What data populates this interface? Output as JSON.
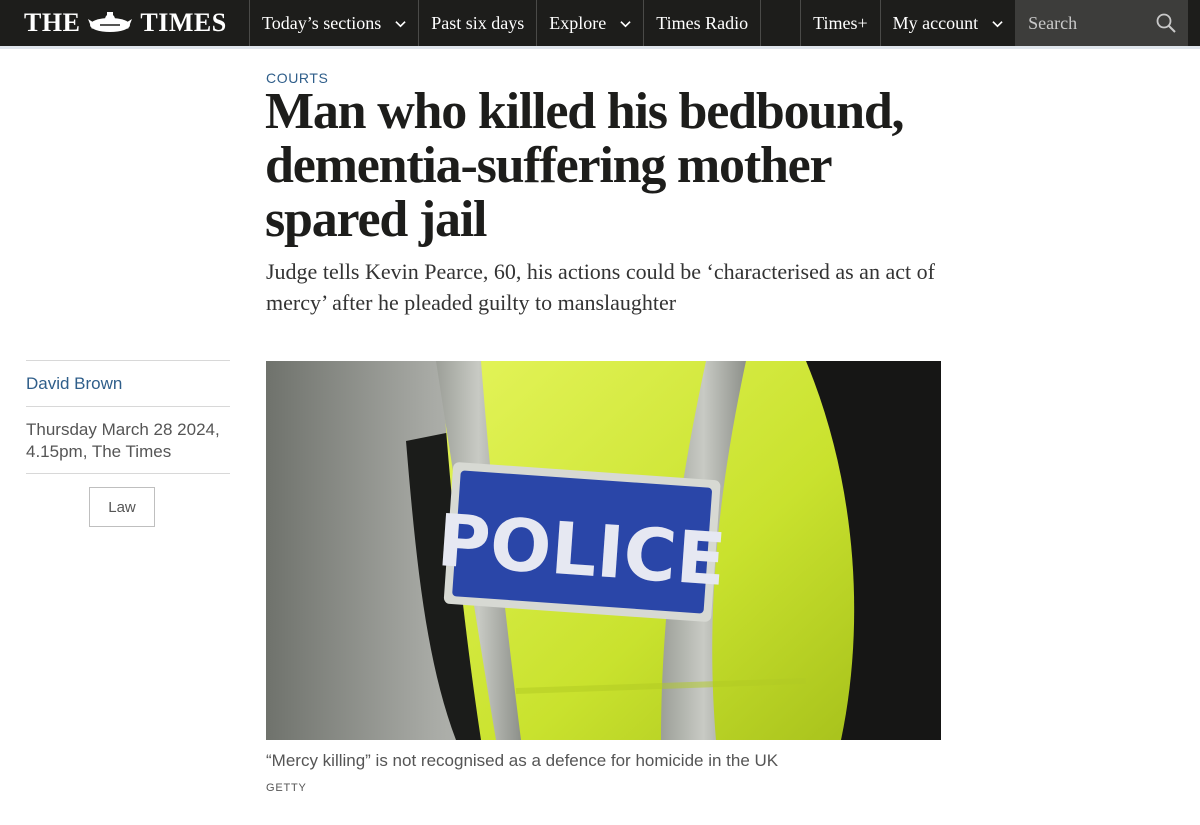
{
  "nav": {
    "logo_text": [
      "THE",
      "TIMES"
    ],
    "items": [
      {
        "label": "Today’s sections",
        "has_dropdown": true
      },
      {
        "label": "Past six days",
        "has_dropdown": false
      },
      {
        "label": "Explore",
        "has_dropdown": true
      },
      {
        "label": "Times Radio",
        "has_dropdown": false
      }
    ],
    "times_plus": "Times+",
    "my_account": "My account",
    "search_placeholder": "Search"
  },
  "article": {
    "section": "COURTS",
    "headline": "Man who killed his bedbound, dementia-suffering mother spared jail",
    "standfirst": "Judge tells Kevin Pearce, 60, his actions could be ‘characterised as an act of mercy’ after he pleaded guilty to manslaughter",
    "author": "David Brown",
    "date_line1": "Thursday March 28 2024,",
    "date_line2": "4.15pm, The Times",
    "tag": "Law",
    "image_caption": "“Mercy killing” is not recognised as a defence for homicide in the UK",
    "image_credit": "GETTY",
    "photo_text": "POLICE"
  },
  "colors": {
    "nav_bg": "#1d1d1b",
    "search_bg": "#3d3d3b",
    "link_blue": "#2f5e8a",
    "hiviz_yellow": "#d8ef3a"
  }
}
